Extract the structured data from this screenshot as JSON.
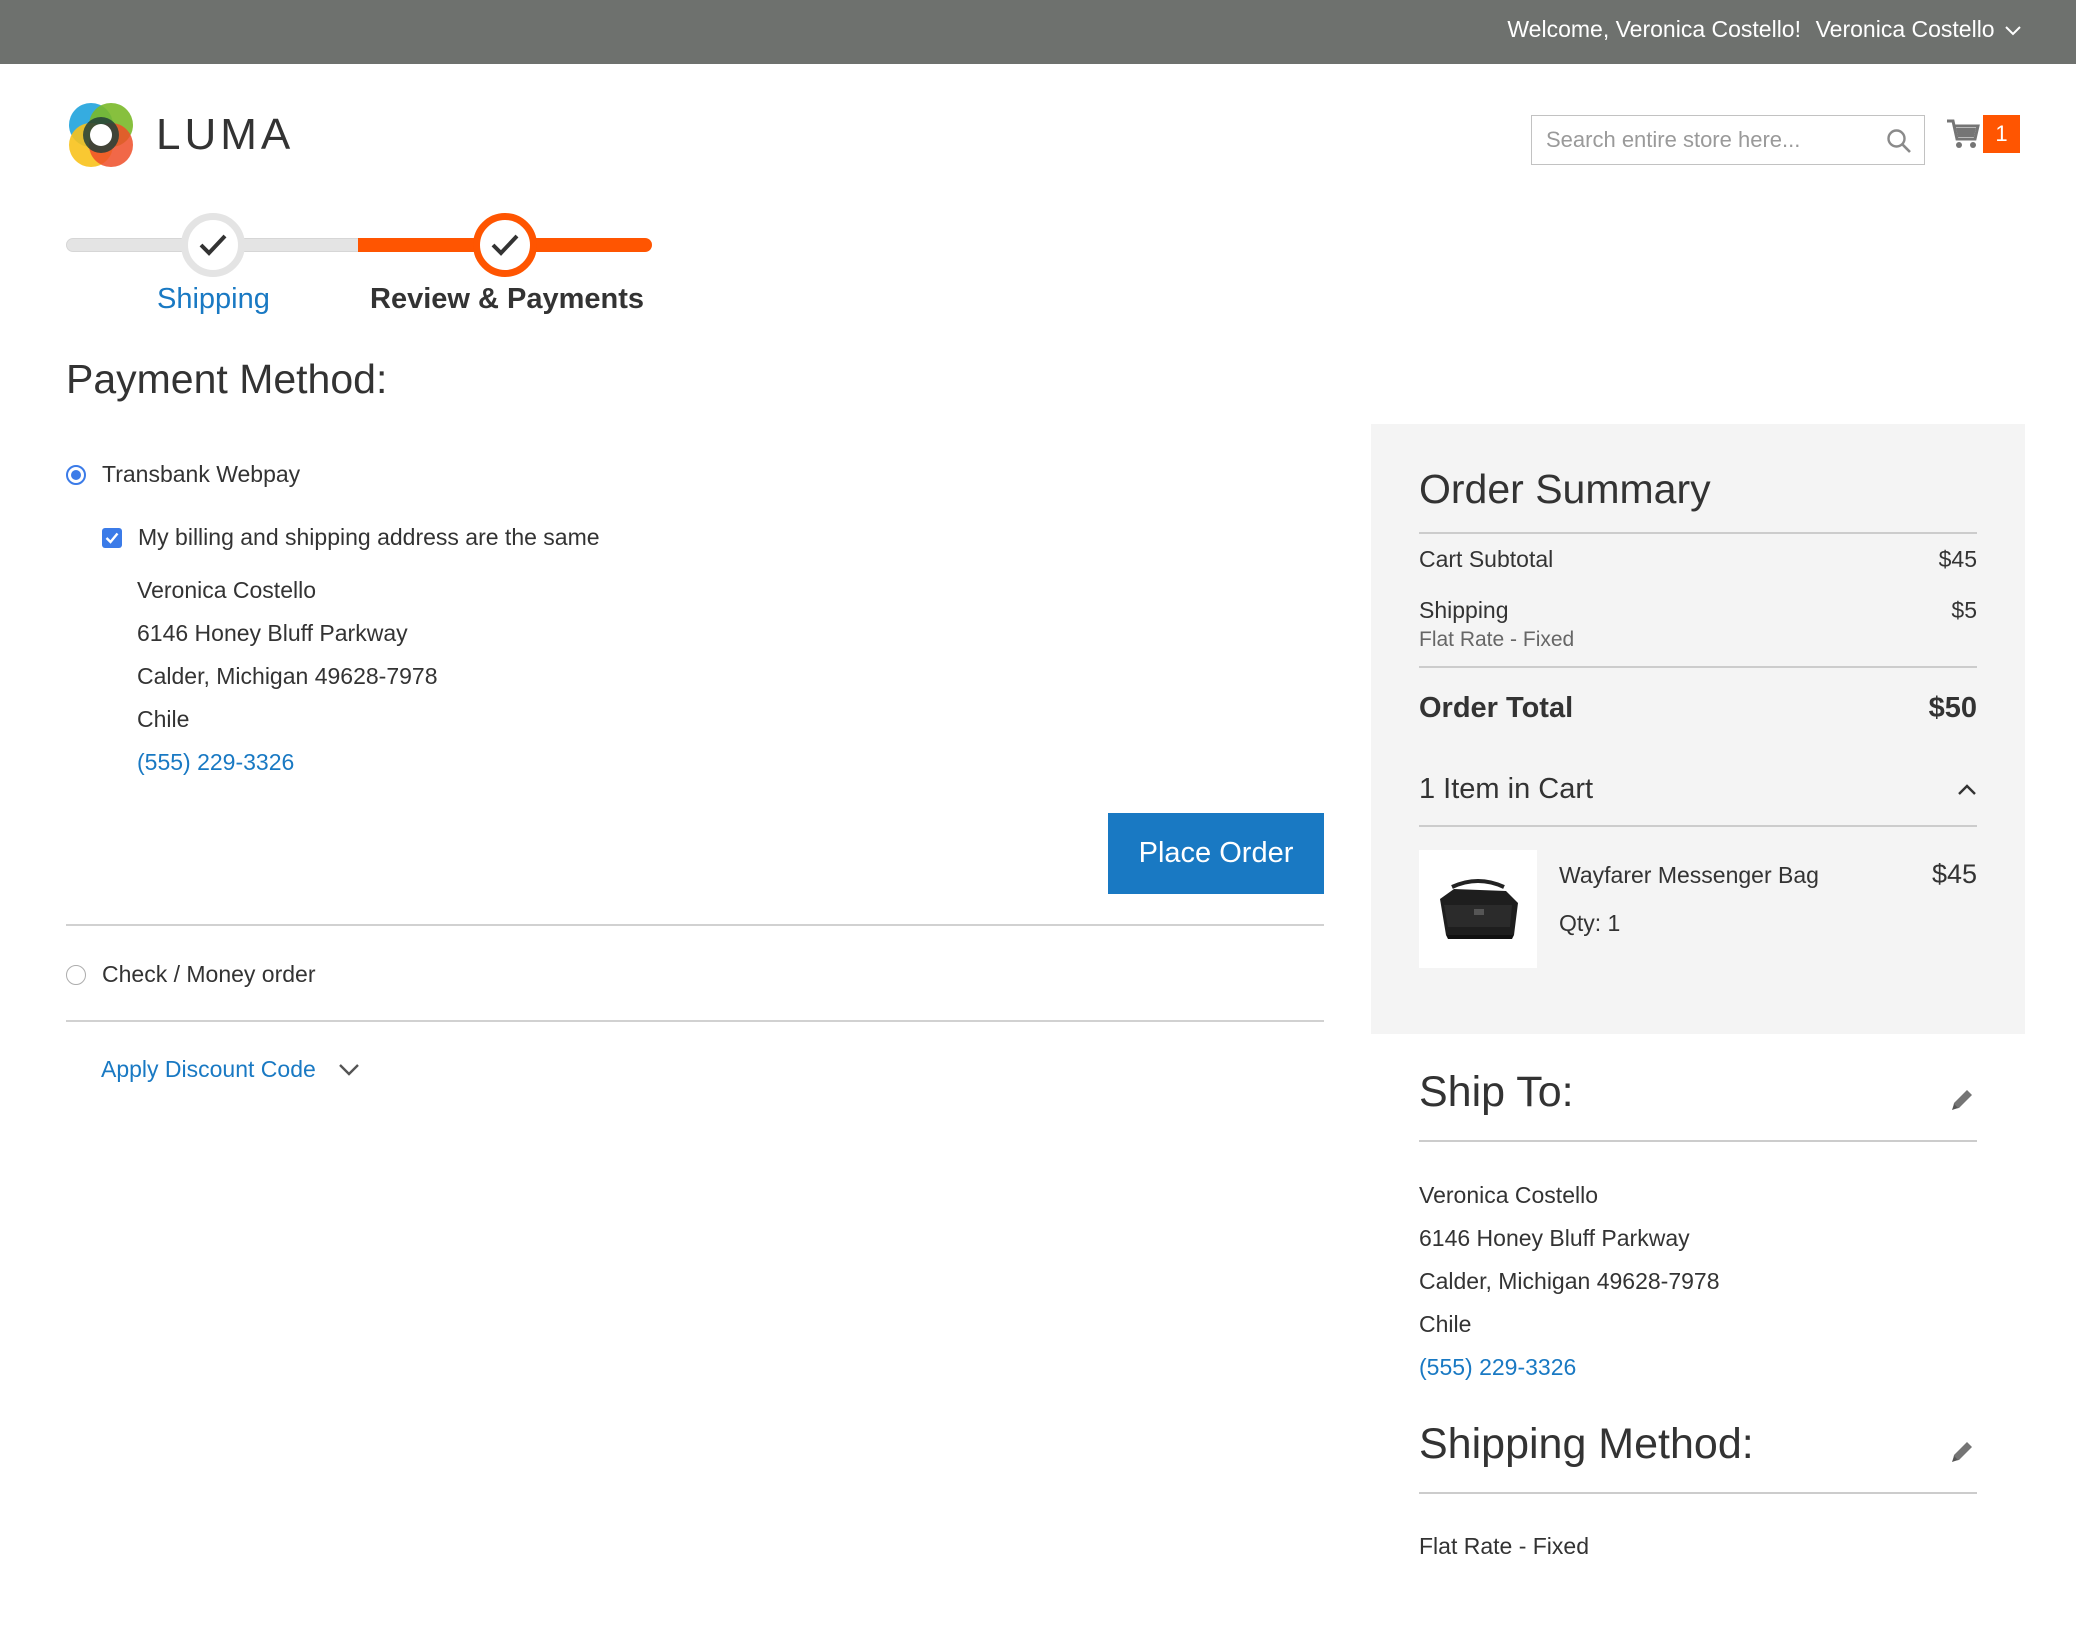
{
  "header": {
    "welcome": "Welcome, Veronica Costello!",
    "account_name": "Veronica Costello",
    "logo_text": "LUMA",
    "search_placeholder": "Search entire store here...",
    "cart_count": "1",
    "accent_color": "#ff5501",
    "link_color": "#1979c3"
  },
  "progress": {
    "steps": [
      {
        "label": "Shipping",
        "status": "complete"
      },
      {
        "label": "Review & Payments",
        "status": "current"
      }
    ]
  },
  "payment": {
    "title": "Payment Method:",
    "methods": [
      {
        "label": "Transbank Webpay",
        "selected": true
      },
      {
        "label": "Check / Money order",
        "selected": false
      }
    ],
    "billing_same_label": "My billing and shipping address are the same",
    "billing_same_checked": true,
    "address": {
      "name": "Veronica Costello",
      "street": "6146 Honey Bluff Parkway",
      "city_line": "Calder, Michigan 49628-7978",
      "country": "Chile",
      "phone": "(555) 229-3326"
    },
    "place_order_label": "Place Order",
    "discount_label": "Apply Discount Code"
  },
  "summary": {
    "title": "Order Summary",
    "subtotal_label": "Cart Subtotal",
    "subtotal_value": "$45",
    "shipping_label": "Shipping",
    "shipping_value": "$5",
    "shipping_method": "Flat Rate - Fixed",
    "total_label": "Order Total",
    "total_value": "$50",
    "items_label": "1 Item in Cart",
    "item": {
      "name": "Wayfarer Messenger Bag",
      "qty": "Qty: 1",
      "price": "$45"
    }
  },
  "ship_to": {
    "title": "Ship To:",
    "name": "Veronica Costello",
    "street": "6146 Honey Bluff Parkway",
    "city_line": "Calder, Michigan 49628-7978",
    "country": "Chile",
    "phone": "(555) 229-3326"
  },
  "shipping_method": {
    "title": "Shipping Method:",
    "value": "Flat Rate - Fixed"
  }
}
